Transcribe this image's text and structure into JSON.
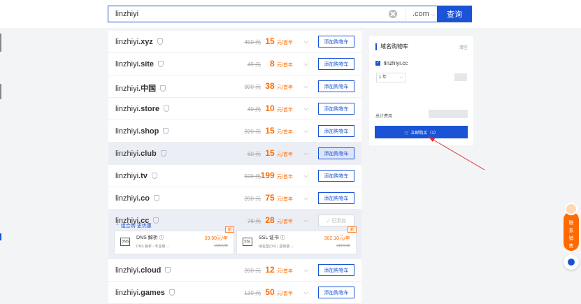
{
  "search": {
    "value": "linzhiyi",
    "tld": ".com",
    "button": "查询"
  },
  "domains": [
    {
      "base": "linzhiyi",
      "tld": ".xyz",
      "old": "450 元",
      "price": "15",
      "unit": "元/首年",
      "button": "添加购物车",
      "state": "normal"
    },
    {
      "base": "linzhiyi",
      "tld": ".site",
      "old": "49 元",
      "price": "8",
      "unit": "元/首年",
      "button": "添加购物车",
      "state": "normal"
    },
    {
      "base": "linzhiyi",
      "tld": ".中国",
      "old": "300 元",
      "price": "38",
      "unit": "元/首年",
      "button": "添加购物车",
      "state": "normal"
    },
    {
      "base": "linzhiyi",
      "tld": ".store",
      "old": "40 元",
      "price": "10",
      "unit": "元/首年",
      "button": "添加购物车",
      "state": "normal"
    },
    {
      "base": "linzhiyi",
      "tld": ".shop",
      "old": "320 元",
      "price": "15",
      "unit": "元/首年",
      "button": "添加购物车",
      "state": "normal"
    },
    {
      "base": "linzhiyi",
      "tld": ".club",
      "old": "60 元",
      "price": "15",
      "unit": "元/首年",
      "button": "添加购物车",
      "state": "hover"
    },
    {
      "base": "linzhiyi",
      "tld": ".tv",
      "old": "500 元",
      "price": "199",
      "unit": "元/首年",
      "button": "添加购物车",
      "state": "normal"
    },
    {
      "base": "linzhiyi",
      "tld": ".co",
      "old": "200 元",
      "price": "75",
      "unit": "元/首年",
      "button": "添加购物车",
      "state": "normal"
    }
  ],
  "cc": {
    "base": "linzhiyi",
    "tld": ".cc",
    "old": "78 元",
    "price": "28",
    "unit": "元/首年",
    "button": "✓ 已添加",
    "bundle": "组合购 更优惠",
    "addons": [
      {
        "tag": "新",
        "icon": "DNS",
        "title": "DNS 解析 ⓘ",
        "sub": "DNS 解析 - 专业版 ⌵",
        "price": "39.90元/年",
        "old": "168元/年"
      },
      {
        "tag": "新",
        "icon": "SSL",
        "title": "SSL 证书 ⓘ",
        "sub": "域名型(DV) | 基础版 ⌵",
        "price": "302.10元/年",
        "old": "318元/年"
      }
    ]
  },
  "domains_after": [
    {
      "base": "linzhiyi",
      "tld": ".cloud",
      "old": "200 元",
      "price": "12",
      "unit": "元/首年",
      "button": "添加购物车",
      "state": "normal"
    },
    {
      "base": "linzhiyi",
      "tld": ".games",
      "old": "130 元",
      "price": "50",
      "unit": "元/首年",
      "button": "添加购物车",
      "state": "normal"
    }
  ],
  "cart": {
    "title": "域名购物车",
    "clear": "清空",
    "item": "linzhiyi.cc",
    "years": "1 年",
    "total_label": "总计费用",
    "buy": "立即购买（1）"
  },
  "promo": {
    "lines": [
      "联",
      "系",
      "销",
      "售"
    ]
  },
  "colors": {
    "accent": "#1a53d6",
    "price": "#ff6a00"
  }
}
